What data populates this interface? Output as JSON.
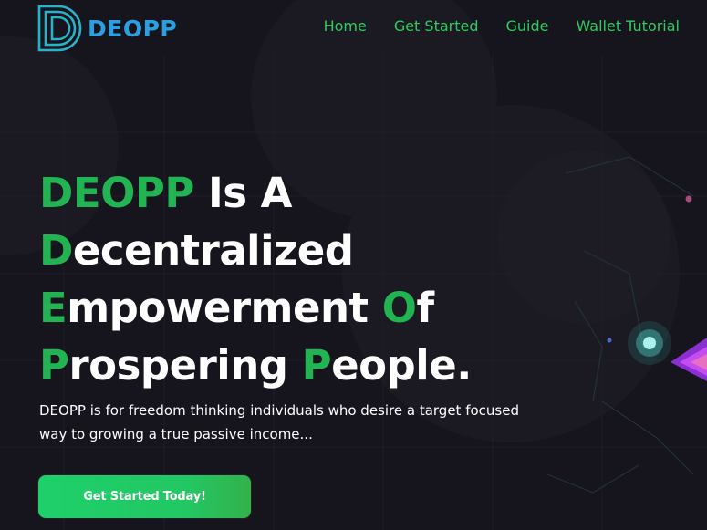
{
  "brand": {
    "name": "DEOPP"
  },
  "nav": [
    {
      "label": "Home"
    },
    {
      "label": "Get Started"
    },
    {
      "label": "Guide"
    },
    {
      "label": "Wallet Tutorial"
    }
  ],
  "hero": {
    "l1_a": "DEOPP",
    "l1_b": " Is A",
    "l2_a": "D",
    "l2_b": "ecentralized",
    "l3_a": "E",
    "l3_b": "mpowerment ",
    "l3_c": "O",
    "l3_d": "f",
    "l4_a": "P",
    "l4_b": "rospering ",
    "l4_c": "P",
    "l4_d": "eople."
  },
  "description": "DEOPP is for freedom thinking individuals who desire a target focused way to growing a true passive income...",
  "cta": {
    "label": "Get Started Today!"
  },
  "colors": {
    "background": "#16141d",
    "accent_green": "#22b452",
    "nav_green": "#2ecc5e",
    "brand_blue": "#2aa0e0"
  }
}
